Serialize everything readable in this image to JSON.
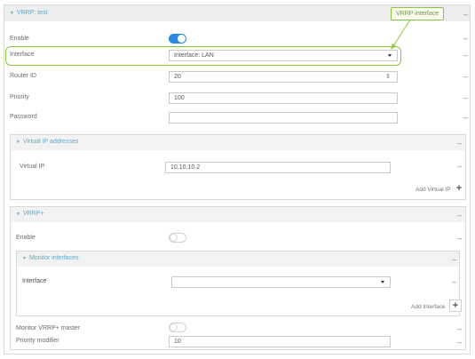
{
  "vrrp_section": {
    "title": "VRRP: test"
  },
  "callout": {
    "text": "VRRP interface"
  },
  "fields": {
    "enable": {
      "label": "Enable"
    },
    "interface": {
      "label": "Interface",
      "value": "Interface: LAN"
    },
    "router_id": {
      "label": "Router ID",
      "value": "20"
    },
    "priority": {
      "label": "Priority",
      "value": "100"
    },
    "password": {
      "label": "Password",
      "value": ""
    }
  },
  "virtual_ip_section": {
    "title": "Virtual IP addresses",
    "virtual_ip": {
      "label": "Virtual IP",
      "value": "10.10.10.2"
    },
    "add_label": "Add Virtual IP"
  },
  "vrrpplus_section": {
    "title": "VRRP+",
    "enable": {
      "label": "Enable"
    },
    "monitor": {
      "title": "Monitor interfaces",
      "interface": {
        "label": "Interface",
        "value": ""
      },
      "add_label": "Add Interface"
    },
    "monitor_master": {
      "label": "Monitor VRRP+ master"
    },
    "priority_modifier": {
      "label": "Priority modifier",
      "value": "10"
    }
  },
  "icons": {
    "minus": "–",
    "plus": "+",
    "caret": "▼"
  },
  "colors": {
    "accent": "#2a8ae0",
    "section_title": "#5ea8c9",
    "callout": "#8cc63f"
  }
}
